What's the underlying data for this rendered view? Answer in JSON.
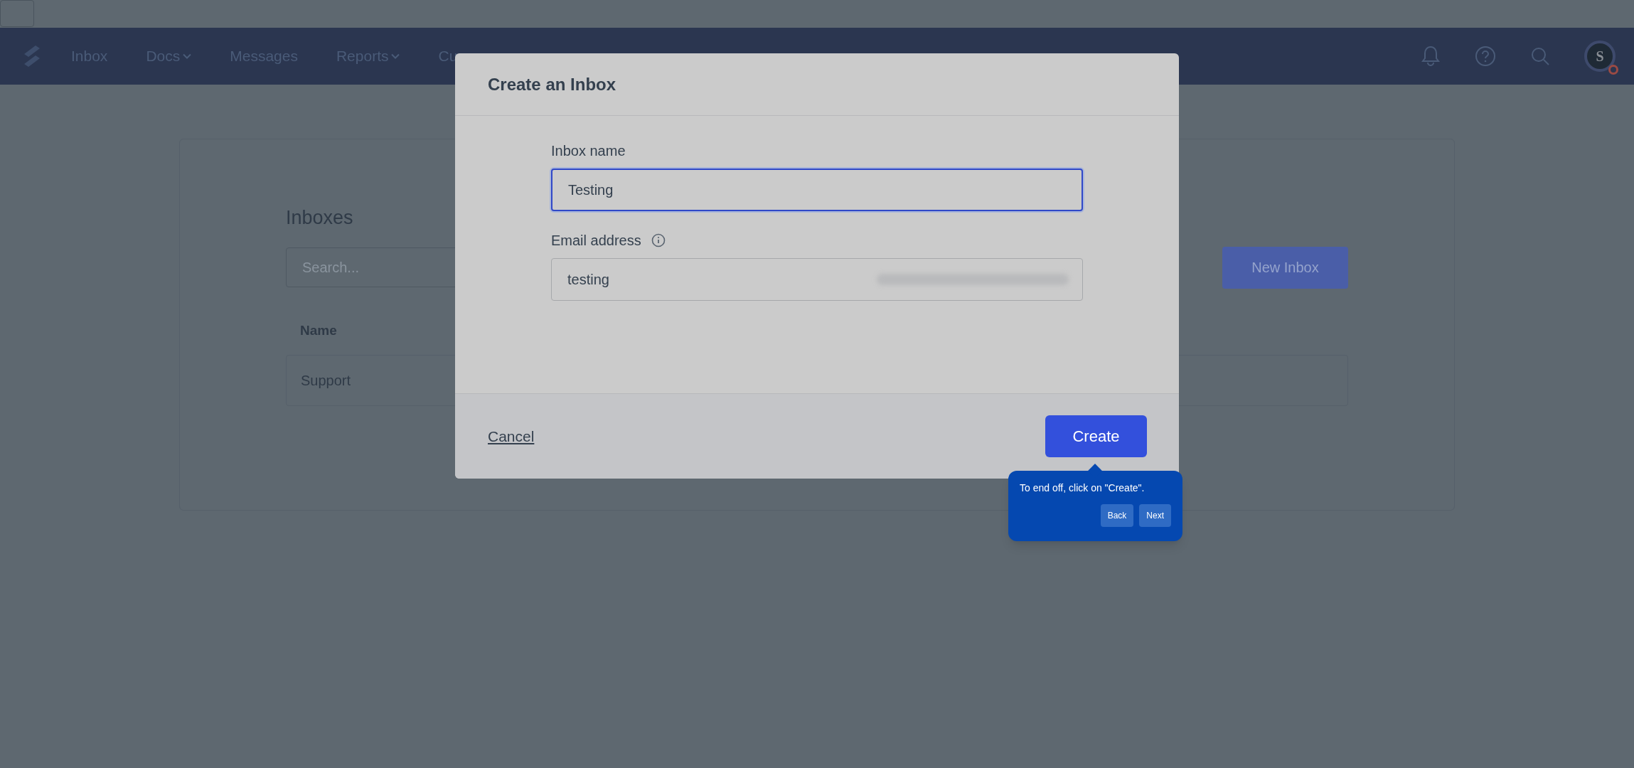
{
  "nav": {
    "items": [
      {
        "label": "Inbox",
        "dropdown": false
      },
      {
        "label": "Docs",
        "dropdown": true
      },
      {
        "label": "Messages",
        "dropdown": false
      },
      {
        "label": "Reports",
        "dropdown": true
      },
      {
        "label": "Cu",
        "dropdown": false
      }
    ],
    "avatar": {
      "initial": "S"
    }
  },
  "page": {
    "title": "Inboxes",
    "search": {
      "placeholder": "Search..."
    },
    "new_button": "New Inbox",
    "table": {
      "columns": [
        "Name"
      ],
      "rows": [
        [
          "Support"
        ]
      ]
    }
  },
  "dialog": {
    "title": "Create an Inbox",
    "fields": [
      {
        "label": "Inbox name",
        "value": "Testing",
        "focused": true,
        "info": false,
        "masked": false
      },
      {
        "label": "Email address",
        "value": "testing",
        "focused": false,
        "info": true,
        "masked": true
      }
    ],
    "cancel": "Cancel",
    "submit": "Create"
  },
  "tour_tip": {
    "text": "To end off, click on \"Create\".",
    "buttons": [
      "Back",
      "Next"
    ]
  }
}
